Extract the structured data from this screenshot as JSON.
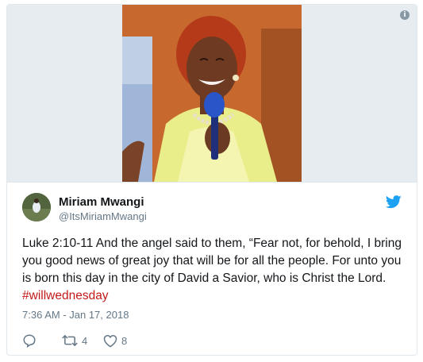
{
  "tweet": {
    "author_name": "Miriam Mwangi",
    "author_handle": "@ItsMiriamMwangi",
    "text_main": "Luke 2:10-11 And the angel said to them, “Fear not, for behold, I bring you good news of great joy that will be for all the people. For unto you is born this day in the city of David a Savior, who is Christ the Lord. ",
    "hashtag": "#willwednesday",
    "timestamp": "7:36 AM - Jan 17, 2018",
    "retweet_count": "4",
    "like_count": "8",
    "info_glyph": "i",
    "hashtag_color": "#c21b1b",
    "brand_color": "#1da1f2"
  },
  "icons": {
    "info": "info-icon",
    "bird": "twitter-bird-icon",
    "reply": "reply-icon",
    "retweet": "retweet-icon",
    "like": "heart-icon"
  }
}
